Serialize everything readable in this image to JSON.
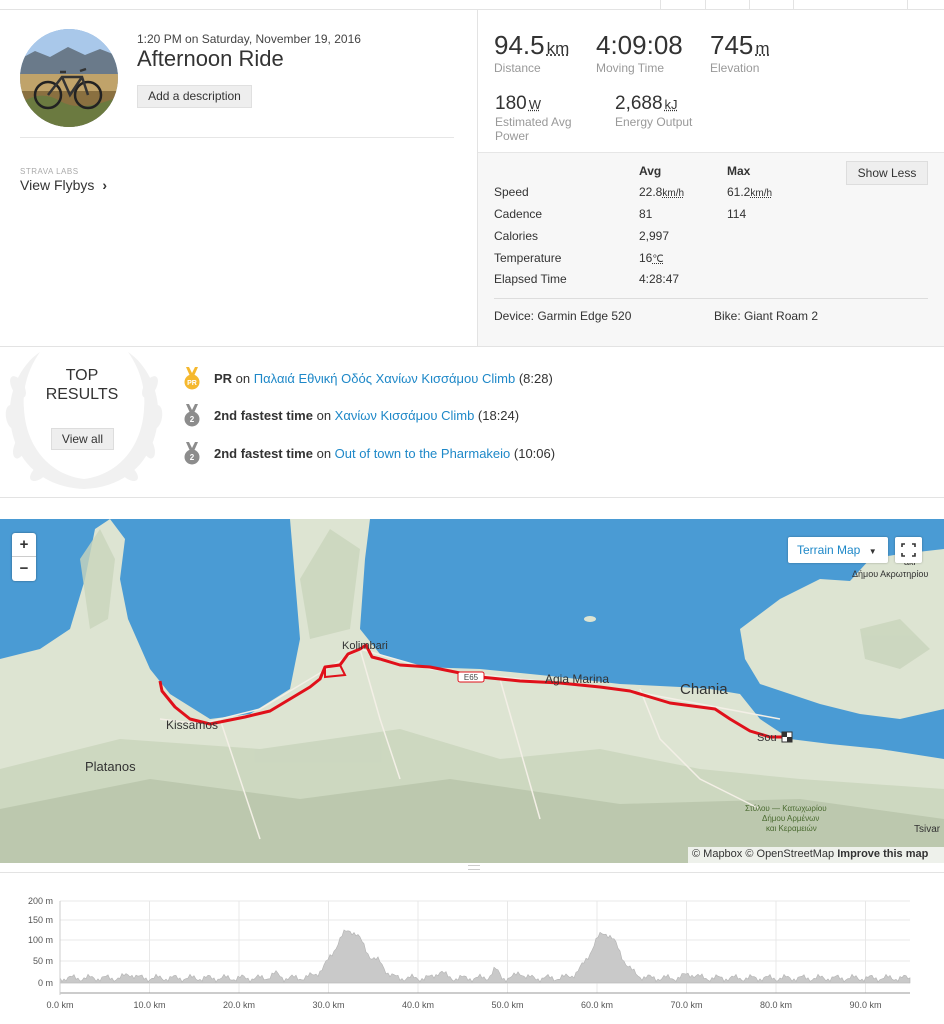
{
  "activity": {
    "datetime": "1:20 PM on Saturday, November 19, 2016",
    "title": "Afternoon Ride",
    "add_description": "Add a description"
  },
  "labs": {
    "label": "STRAVA LABS",
    "link": "View Flybys",
    "chevron": "›"
  },
  "stats": [
    {
      "value": "94.5",
      "unit": "km",
      "label": "Distance"
    },
    {
      "value": "4:09:08",
      "unit": "",
      "label": "Moving Time"
    },
    {
      "value": "745",
      "unit": "m",
      "label": "Elevation"
    }
  ],
  "stats2": [
    {
      "value": "180",
      "unit": "W",
      "label": "Estimated Avg Power"
    },
    {
      "value": "2,688",
      "unit": "kJ",
      "label": "Energy Output"
    }
  ],
  "details": {
    "avg_header": "Avg",
    "max_header": "Max",
    "show_less": "Show Less",
    "rows": [
      {
        "label": "Speed",
        "avg": "22.8",
        "avg_unit": "km/h",
        "max": "61.2",
        "max_unit": "km/h"
      },
      {
        "label": "Cadence",
        "avg": "81",
        "avg_unit": "",
        "max": "114",
        "max_unit": ""
      },
      {
        "label": "Calories",
        "avg": "2,997",
        "avg_unit": "",
        "max": "",
        "max_unit": ""
      },
      {
        "label": "Temperature",
        "avg": "16",
        "avg_unit": "℃",
        "max": "",
        "max_unit": ""
      },
      {
        "label": "Elapsed Time",
        "avg": "4:28:47",
        "avg_unit": "",
        "max": "",
        "max_unit": ""
      }
    ],
    "device": "Device: Garmin Edge 520",
    "bike": "Bike: Giant Roam 2"
  },
  "top_results": {
    "heading_line1": "TOP",
    "heading_line2": "RESULTS",
    "view_all": "View all",
    "items": [
      {
        "medal": "PR",
        "bold": "PR",
        "on": " on ",
        "segment": "Παλαιά Εθνική Οδός Χανίων Κισσάμου Climb",
        "time": " (8:28)",
        "medal_color": "#f5b82e"
      },
      {
        "medal": "2",
        "bold": "2nd fastest time",
        "on": " on ",
        "segment": "Χανίων Κισσάμου Climb",
        "time": " (18:24)",
        "medal_color": "#8c8c8c"
      },
      {
        "medal": "2",
        "bold": "2nd fastest time",
        "on": " on ",
        "segment": "Out of town to the Pharmakeio",
        "time": " (10:06)",
        "medal_color": "#8c8c8c"
      }
    ]
  },
  "map": {
    "zoom_in": "+",
    "zoom_out": "−",
    "terrain_label": "Terrain Map",
    "terrain_caret": "▼",
    "fullscreen_icon": "⤢",
    "attribution_prefix": "© Mapbox © OpenStreetMap ",
    "attribution_link": "Improve this map",
    "places": {
      "kolimbari": "Kolimbari",
      "kissamos": "Kissamos",
      "platanos": "Platanos",
      "agia_marina": "Agia Marina",
      "chania": "Chania",
      "souda": "Sou",
      "akrotiri1": "aki",
      "akrotiri2": "Δήμου Ακρωτηρίου",
      "stylos1": "Στύλου — Κατωχωρίου",
      "stylos2": "Δήμου Αρμένων",
      "stylos3": "και Κεραμειών",
      "tsivar": "Tsivar",
      "e65": "E65"
    },
    "colors": {
      "sea": "#4a9bd4",
      "land": "#dde4d2",
      "route": "#e0101a"
    }
  },
  "elevation": {
    "y_labels": [
      "200 m",
      "150 m",
      "100 m",
      "50 m",
      "0 m"
    ],
    "x_labels": [
      "0.0 km",
      "10.0 km",
      "20.0 km",
      "30.0 km",
      "40.0 km",
      "50.0 km",
      "60.0 km",
      "70.0 km",
      "80.0 km",
      "90.0 km"
    ]
  }
}
